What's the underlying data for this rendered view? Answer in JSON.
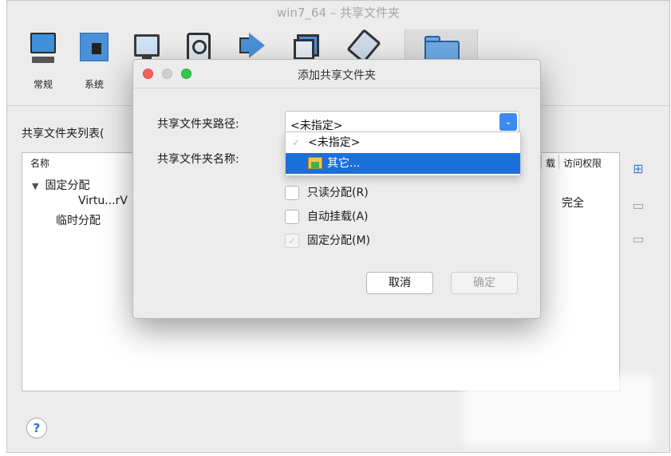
{
  "window": {
    "title": "win7_64 – 共享文件夹"
  },
  "toolbar": {
    "items": [
      {
        "label": "常规",
        "icon": "monitor-icon"
      },
      {
        "label": "系统",
        "icon": "chip-icon"
      },
      {
        "label": "",
        "icon": "display-icon"
      },
      {
        "label": "",
        "icon": "storage-icon"
      },
      {
        "label": "",
        "icon": "audio-icon"
      },
      {
        "label": "",
        "icon": "network-icon"
      },
      {
        "label": "",
        "icon": "usb-icon"
      },
      {
        "label": "",
        "icon": "shared-folder-icon"
      }
    ]
  },
  "folder_list": {
    "title": "共享文件夹列表(",
    "columns": {
      "name": "名称",
      "auto": "载",
      "access": "访问权限"
    },
    "tree": {
      "fixed_group": "固定分配",
      "fixed_item": "Virtu...rV",
      "fixed_item_access": "完全",
      "temp_group": "临时分配"
    }
  },
  "help": {
    "label": "?"
  },
  "dialog": {
    "title": "添加共享文件夹",
    "path_label": "共享文件夹路径:",
    "name_label": "共享文件夹名称:",
    "path_value": "<未指定>",
    "dropdown": {
      "items": [
        {
          "label": "<未指定>",
          "checked": true
        },
        {
          "label": "其它...",
          "selected": true
        }
      ]
    },
    "checkboxes": [
      {
        "label": "只读分配(R)",
        "checked": false,
        "enabled": true
      },
      {
        "label": "自动挂载(A)",
        "checked": false,
        "enabled": true
      },
      {
        "label": "固定分配(M)",
        "checked": true,
        "enabled": false
      }
    ],
    "buttons": {
      "cancel": "取消",
      "ok": "确定"
    }
  },
  "colors": {
    "accent": "#3d8bf2",
    "selection": "#1c6fd9",
    "close": "#fc605b",
    "zoom": "#34c84a"
  }
}
